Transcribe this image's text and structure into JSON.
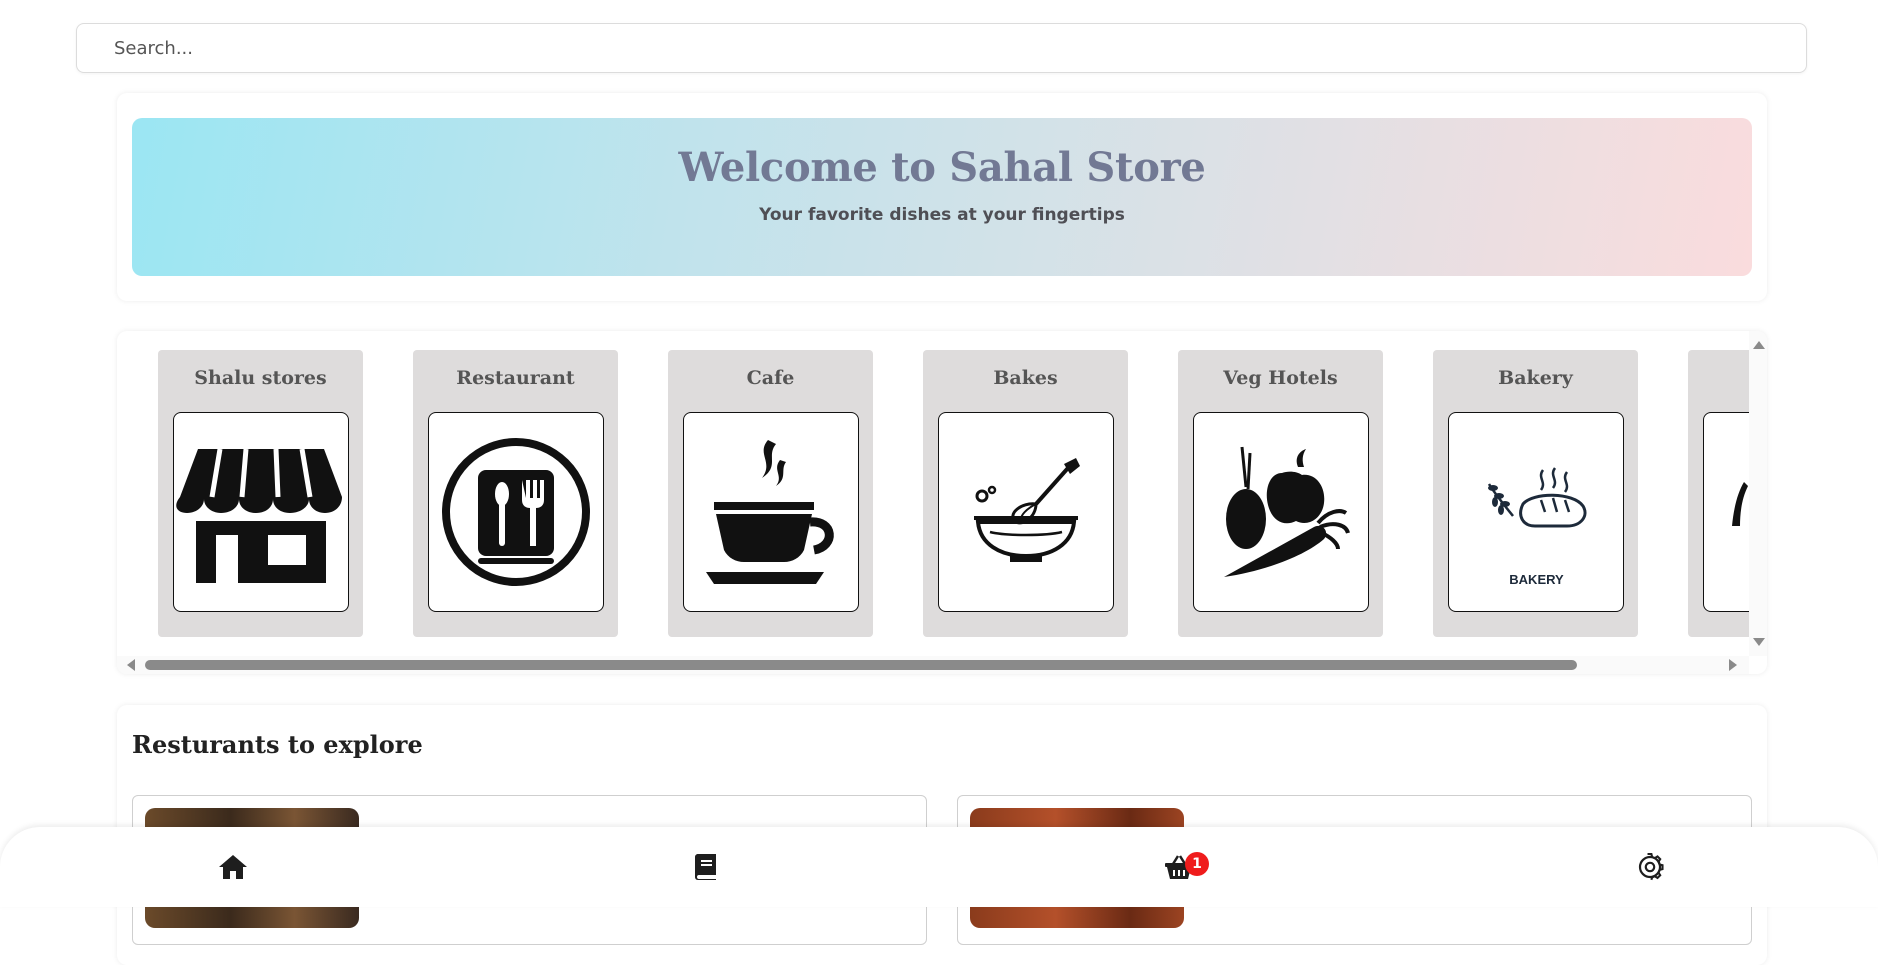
{
  "search": {
    "placeholder": "Search..."
  },
  "hero": {
    "title": "Welcome to Sahal Store",
    "subtitle": "Your favorite dishes at your fingertips"
  },
  "categories": [
    {
      "name": "Shalu stores",
      "icon": "storefront-icon"
    },
    {
      "name": "Restaurant",
      "icon": "restaurant-menu-icon"
    },
    {
      "name": "Cafe",
      "icon": "coffee-cup-icon"
    },
    {
      "name": "Bakes",
      "icon": "mixing-bowl-whisk-icon"
    },
    {
      "name": "Veg Hotels",
      "icon": "vegetables-icon"
    },
    {
      "name": "Bakery",
      "icon": "bakery-bread-icon",
      "icon_text": "BAKERY"
    },
    {
      "name": "",
      "icon": "partial-category-icon"
    }
  ],
  "restaurants": {
    "title": "Resturants to explore"
  },
  "nav": {
    "cart_count": "1",
    "items": [
      "home-icon",
      "book-icon",
      "cart-icon",
      "gear-icon"
    ]
  }
}
